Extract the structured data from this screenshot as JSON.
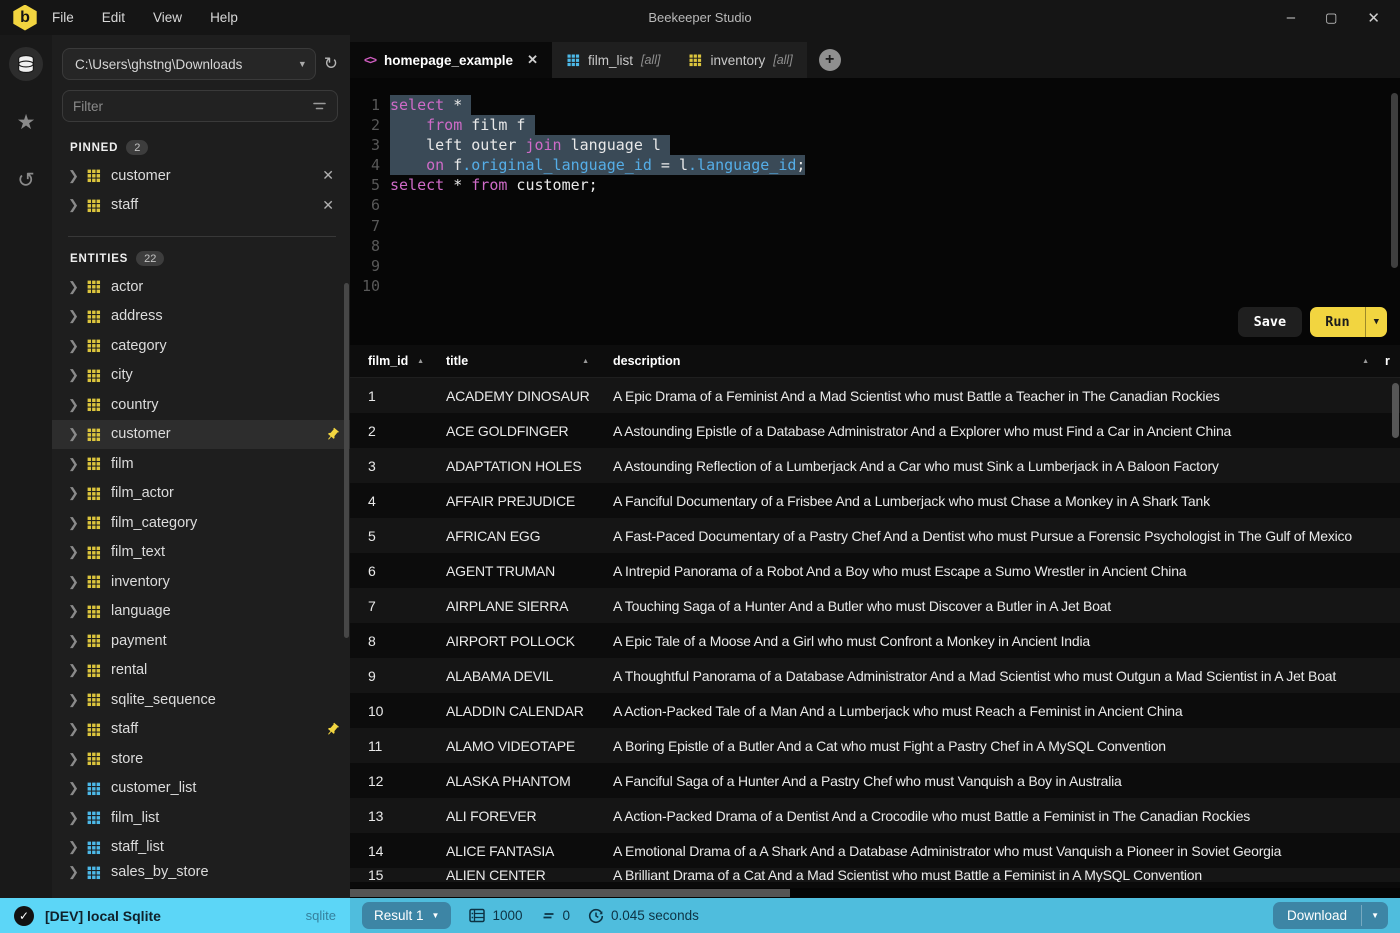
{
  "window": {
    "title": "Beekeeper Studio",
    "menus": [
      "File",
      "Edit",
      "View",
      "Help"
    ],
    "controls": {
      "minimize": "–",
      "maximize": "▢",
      "close": "✕"
    }
  },
  "sidebar": {
    "connection_path": "C:\\Users\\ghstng\\Downloads",
    "filter_placeholder": "Filter",
    "pinned": {
      "label": "PINNED",
      "count": "2",
      "items": [
        {
          "name": "customer",
          "icon": "table-icon"
        },
        {
          "name": "staff",
          "icon": "table-icon"
        }
      ]
    },
    "entities": {
      "label": "ENTITIES",
      "count": "22",
      "items": [
        {
          "name": "actor",
          "icon": "table-icon"
        },
        {
          "name": "address",
          "icon": "table-icon"
        },
        {
          "name": "category",
          "icon": "table-icon"
        },
        {
          "name": "city",
          "icon": "table-icon"
        },
        {
          "name": "country",
          "icon": "table-icon"
        },
        {
          "name": "customer",
          "icon": "table-icon",
          "selected": true,
          "pinned": true
        },
        {
          "name": "film",
          "icon": "table-icon"
        },
        {
          "name": "film_actor",
          "icon": "table-icon"
        },
        {
          "name": "film_category",
          "icon": "table-icon"
        },
        {
          "name": "film_text",
          "icon": "table-icon"
        },
        {
          "name": "inventory",
          "icon": "table-icon"
        },
        {
          "name": "language",
          "icon": "table-icon"
        },
        {
          "name": "payment",
          "icon": "table-icon"
        },
        {
          "name": "rental",
          "icon": "table-icon"
        },
        {
          "name": "sqlite_sequence",
          "icon": "table-icon"
        },
        {
          "name": "staff",
          "icon": "table-icon",
          "pinned": true
        },
        {
          "name": "store",
          "icon": "table-icon"
        },
        {
          "name": "customer_list",
          "icon": "view-icon"
        },
        {
          "name": "film_list",
          "icon": "view-icon"
        },
        {
          "name": "staff_list",
          "icon": "view-icon"
        },
        {
          "name": "sales_by_store",
          "icon": "view-icon",
          "cut": true
        }
      ]
    }
  },
  "tabs": [
    {
      "label": "homepage_example",
      "icon": "code-icon",
      "active": true,
      "closable": true
    },
    {
      "label": "film_list",
      "suffix": "[all]",
      "icon": "view-icon"
    },
    {
      "label": "inventory",
      "suffix": "[all]",
      "icon": "table-icon"
    }
  ],
  "editor": {
    "lines": [
      {
        "n": "1",
        "sel": true,
        "tokens": [
          [
            "kw",
            "select"
          ],
          [
            "pl",
            " * "
          ]
        ]
      },
      {
        "n": "2",
        "sel": true,
        "tokens": [
          [
            "pl",
            "    "
          ],
          [
            "kw",
            "from"
          ],
          [
            "pl",
            " film f "
          ]
        ]
      },
      {
        "n": "3",
        "sel": true,
        "tokens": [
          [
            "pl",
            "    left outer "
          ],
          [
            "kw",
            "join"
          ],
          [
            "pl",
            " language l "
          ]
        ]
      },
      {
        "n": "4",
        "sel": true,
        "tokens": [
          [
            "pl",
            "    "
          ],
          [
            "kw",
            "on"
          ],
          [
            "pl",
            " f"
          ],
          [
            "id",
            ".original_language_id"
          ],
          [
            "pl",
            " = l"
          ],
          [
            "id",
            ".language_id"
          ],
          [
            "pl",
            ";"
          ]
        ]
      },
      {
        "n": "5",
        "sel": false,
        "tokens": [
          [
            "kw",
            "select"
          ],
          [
            "pl",
            " * "
          ],
          [
            "kw",
            "from"
          ],
          [
            "pl",
            " customer;"
          ]
        ]
      },
      {
        "n": "6",
        "sel": false,
        "tokens": []
      },
      {
        "n": "7",
        "sel": false,
        "tokens": []
      },
      {
        "n": "8",
        "sel": false,
        "tokens": []
      },
      {
        "n": "9",
        "sel": false,
        "tokens": []
      },
      {
        "n": "10",
        "sel": false,
        "tokens": []
      }
    ]
  },
  "toolbar": {
    "save_label": "Save",
    "run_label": "Run"
  },
  "results": {
    "columns": [
      "film_id",
      "title",
      "description",
      "r"
    ],
    "rows": [
      [
        "1",
        "ACADEMY DINOSAUR",
        "A Epic Drama of a Feminist And a Mad Scientist who must Battle a Teacher in The Canadian Rockies"
      ],
      [
        "2",
        "ACE GOLDFINGER",
        "A Astounding Epistle of a Database Administrator And a Explorer who must Find a Car in Ancient China"
      ],
      [
        "3",
        "ADAPTATION HOLES",
        "A Astounding Reflection of a Lumberjack And a Car who must Sink a Lumberjack in A Baloon Factory"
      ],
      [
        "4",
        "AFFAIR PREJUDICE",
        "A Fanciful Documentary of a Frisbee And a Lumberjack who must Chase a Monkey in A Shark Tank"
      ],
      [
        "5",
        "AFRICAN EGG",
        "A Fast-Paced Documentary of a Pastry Chef And a Dentist who must Pursue a Forensic Psychologist in The Gulf of Mexico"
      ],
      [
        "6",
        "AGENT TRUMAN",
        "A Intrepid Panorama of a Robot And a Boy who must Escape a Sumo Wrestler in Ancient China"
      ],
      [
        "7",
        "AIRPLANE SIERRA",
        "A Touching Saga of a Hunter And a Butler who must Discover a Butler in A Jet Boat"
      ],
      [
        "8",
        "AIRPORT POLLOCK",
        "A Epic Tale of a Moose And a Girl who must Confront a Monkey in Ancient India"
      ],
      [
        "9",
        "ALABAMA DEVIL",
        "A Thoughtful Panorama of a Database Administrator And a Mad Scientist who must Outgun a Mad Scientist in A Jet Boat"
      ],
      [
        "10",
        "ALADDIN CALENDAR",
        "A Action-Packed Tale of a Man And a Lumberjack who must Reach a Feminist in Ancient China"
      ],
      [
        "11",
        "ALAMO VIDEOTAPE",
        "A Boring Epistle of a Butler And a Cat who must Fight a Pastry Chef in A MySQL Convention"
      ],
      [
        "12",
        "ALASKA PHANTOM",
        "A Fanciful Saga of a Hunter And a Pastry Chef who must Vanquish a Boy in Australia"
      ],
      [
        "13",
        "ALI FOREVER",
        "A Action-Packed Drama of a Dentist And a Crocodile who must Battle a Feminist in The Canadian Rockies"
      ],
      [
        "14",
        "ALICE FANTASIA",
        "A Emotional Drama of a A Shark And a Database Administrator who must Vanquish a Pioneer in Soviet Georgia"
      ],
      [
        "15",
        "ALIEN CENTER",
        "A Brilliant Drama of a Cat And a Mad Scientist who must Battle a Feminist in A MySQL Convention",
        "cut"
      ]
    ]
  },
  "statusbar": {
    "connection": "[DEV] local Sqlite",
    "db_type": "sqlite",
    "result_label": "Result 1",
    "row_count": "1000",
    "affected_count": "0",
    "elapsed": "0.045 seconds",
    "download_label": "Download"
  },
  "colors": {
    "accent_yellow": "#f2d540",
    "view_blue": "#4db9e8",
    "table_yellow": "#dcc53d",
    "status_cyan_left": "#5cd6f7",
    "status_cyan_right": "#4fbddd",
    "status_button": "#3d85a5",
    "keyword_pink": "#cf6bc8",
    "identifier_blue": "#55aee8",
    "selection": "#3a4a57"
  }
}
